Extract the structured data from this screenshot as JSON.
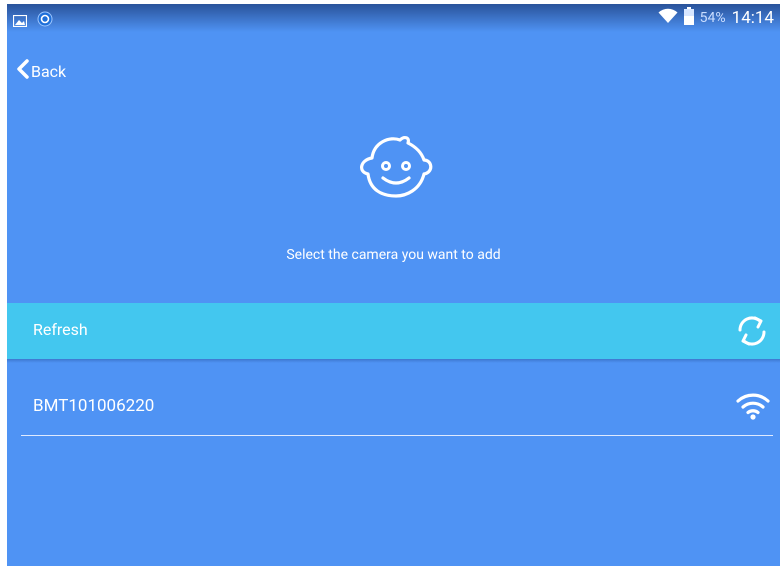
{
  "status_bar": {
    "battery_percent": "54%",
    "time": "14:14",
    "icons": [
      "gallery-icon",
      "app-notification-icon",
      "wifi-icon",
      "battery-icon"
    ]
  },
  "header": {
    "back_label": "Back"
  },
  "main": {
    "illustration": "baby-face-icon",
    "prompt": "Select the camera you want to add"
  },
  "refresh": {
    "label": "Refresh",
    "icon": "refresh-icon"
  },
  "cameras": [
    {
      "name": "BMT101006220",
      "icon": "wifi-signal-icon"
    }
  ],
  "colors": {
    "background": "#4f93f4",
    "refresh_bar": "#43c7ef",
    "text": "#ffffff"
  }
}
